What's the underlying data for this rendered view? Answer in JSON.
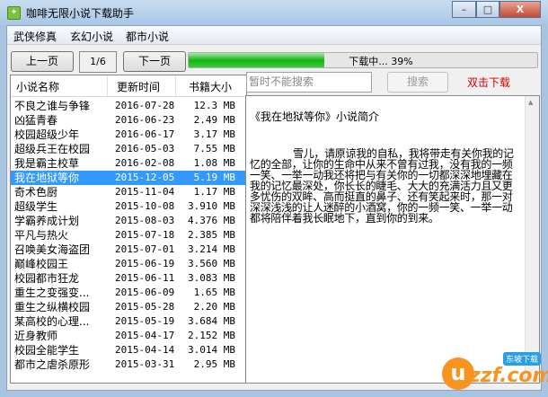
{
  "window": {
    "title": "咖啡无限小说下载助手",
    "minimize": "–",
    "maximize": "□",
    "close": "X"
  },
  "menu": [
    "武侠修真",
    "玄幻小说",
    "都市小说"
  ],
  "pager": {
    "prev": "上一页",
    "page": "1/6",
    "next": "下一页"
  },
  "progress": {
    "percent": 39,
    "text": "下载中... 39%"
  },
  "list": {
    "headers": [
      "小说名称",
      "更新时间",
      "书籍大小"
    ],
    "selected_index": 5,
    "rows": [
      [
        "不良之谁与争锋",
        "2016-07-28",
        "12.3 MB"
      ],
      [
        "凶猛青春",
        "2016-06-23",
        "2.49 MB"
      ],
      [
        "校园超级少年",
        "2016-06-17",
        "3.17 MB"
      ],
      [
        "超级兵王在校园",
        "2016-05-03",
        "7.55 MB"
      ],
      [
        "我是霸主校草",
        "2016-02-08",
        "1.08 MB"
      ],
      [
        "我在地狱等你",
        "2015-12-05",
        "5.19 MB"
      ],
      [
        "奇术色厨",
        "2015-11-04",
        "1.17 MB"
      ],
      [
        "超级学生",
        "2015-10-08",
        "3.910 MB"
      ],
      [
        "学霸养成计划",
        "2015-08-03",
        "4.376 MB"
      ],
      [
        "平凡与热火",
        "2015-07-18",
        "2.385 MB"
      ],
      [
        "召唤美女海盗团",
        "2015-07-01",
        "3.214 MB"
      ],
      [
        "巅峰校园王",
        "2015-06-19",
        "3.560 MB"
      ],
      [
        "校园都市狂龙",
        "2015-06-11",
        "3.083 MB"
      ],
      [
        "重生之变强变...",
        "2015-06-09",
        "1.65 MB"
      ],
      [
        "重生之纵横校园",
        "2015-05-28",
        "2.20 MB"
      ],
      [
        "某高校的心理...",
        "2015-05-19",
        "3.684 MB"
      ],
      [
        "近身教师",
        "2015-04-17",
        "2.152 MB"
      ],
      [
        "校园全能学生",
        "2015-04-14",
        "3.014 MB"
      ],
      [
        "都市之虐杀原形",
        "2015-03-31",
        "2.95 MB"
      ]
    ]
  },
  "search": {
    "placeholder": "暂时不能搜索",
    "button": "搜索",
    "download_hint": "双击下载"
  },
  "detail": {
    "title": "《我在地狱等你》小说简介",
    "body": "雪儿，请原谅我的自私，我将带走有关你我的记忆的全部，让你的生命中从来不曾有过我，没有我的一频一笑、一举一动我还将把与有关你的一切都深深地埋藏在我的记忆最深处，你长长的睫毛、大大的充满活力且又更多忧伤的双眸、高而挺直的鼻子、还有笑起来时，那一对深深浅浅的让人迷醉的小酒窝，你的一频一笑、一举一动都将陪伴着我长眠地下，直到你的到来。"
  },
  "watermark": {
    "logo": "uzzf.com",
    "badge": "东坡下载"
  },
  "colors": {
    "accent_green": "#13b513",
    "selection": "#3399ff",
    "hint_red": "#d40000"
  }
}
